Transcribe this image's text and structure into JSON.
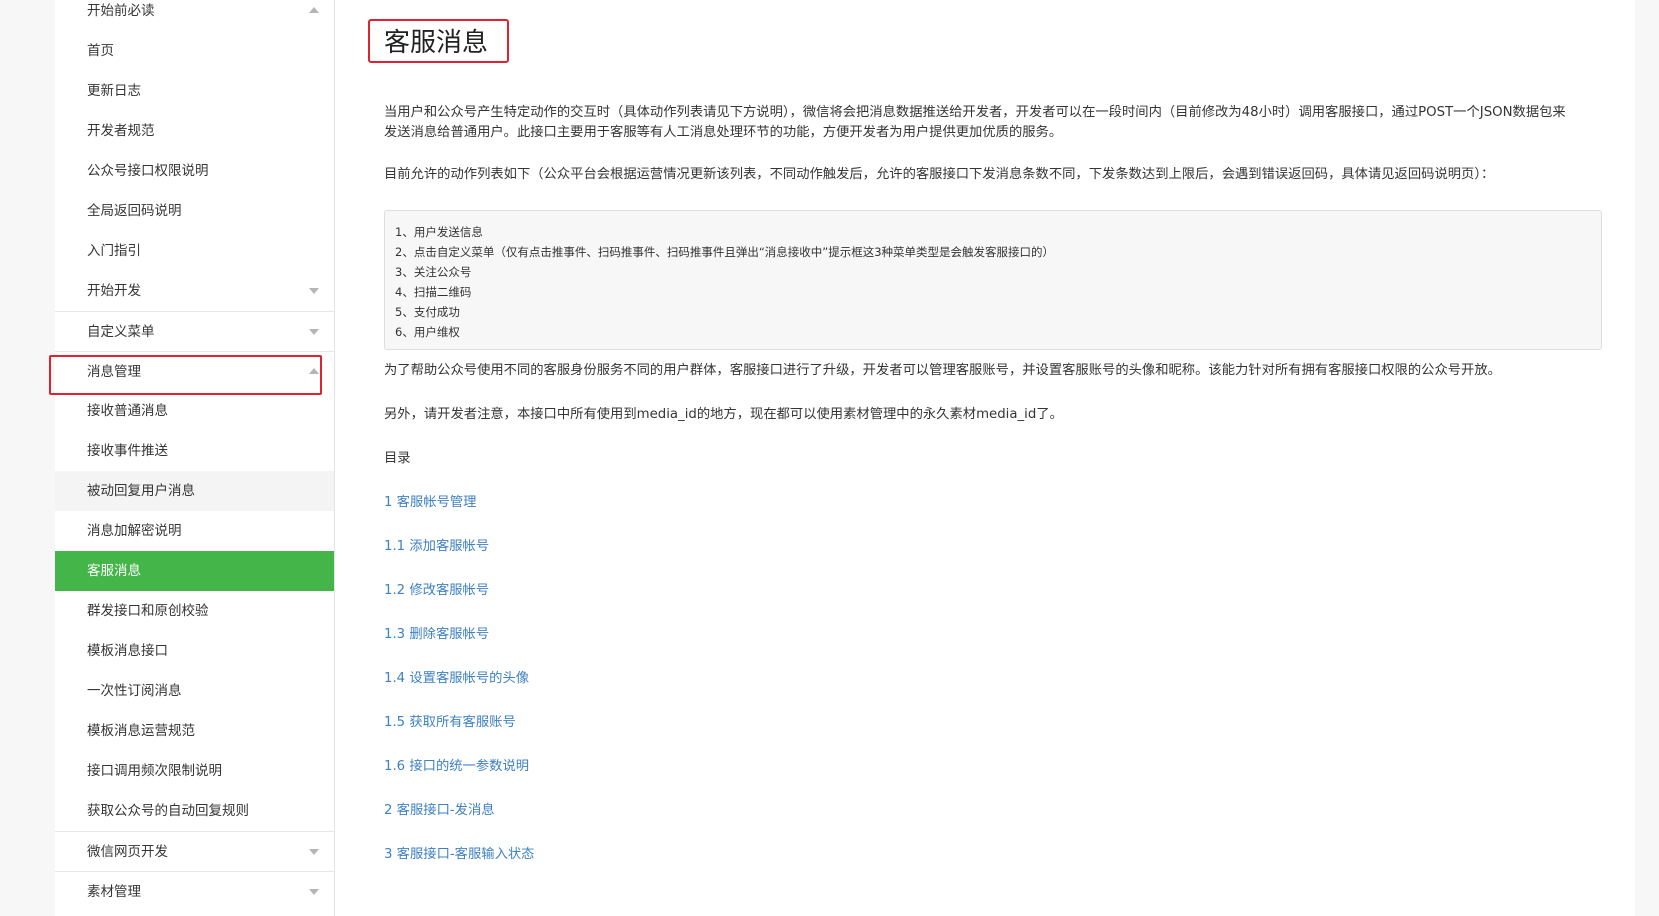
{
  "sidebar": {
    "items": [
      {
        "label": "开始前必读",
        "caret": "up",
        "group": false
      },
      {
        "label": "首页"
      },
      {
        "label": "更新日志"
      },
      {
        "label": "开发者规范"
      },
      {
        "label": "公众号接口权限说明"
      },
      {
        "label": "全局返回码说明"
      },
      {
        "label": "入门指引"
      },
      {
        "label": "开始开发",
        "caret": "down"
      },
      {
        "label": "自定义菜单",
        "caret": "down",
        "group": true
      },
      {
        "label": "消息管理",
        "caret": "up",
        "group": true
      },
      {
        "label": "接收普通消息"
      },
      {
        "label": "接收事件推送"
      },
      {
        "label": "被动回复用户消息",
        "state": "hover"
      },
      {
        "label": "消息加解密说明"
      },
      {
        "label": "客服消息",
        "state": "active"
      },
      {
        "label": "群发接口和原创校验"
      },
      {
        "label": "模板消息接口"
      },
      {
        "label": "一次性订阅消息"
      },
      {
        "label": "模板消息运营规范"
      },
      {
        "label": "接口调用频次限制说明"
      },
      {
        "label": "获取公众号的自动回复规则"
      },
      {
        "label": "微信网页开发",
        "caret": "down",
        "group": true
      },
      {
        "label": "素材管理",
        "caret": "down",
        "group": true
      }
    ]
  },
  "main": {
    "title": "客服消息",
    "intro": "当用户和公众号产生特定动作的交互时（具体动作列表请见下方说明），微信将会把消息数据推送给开发者，开发者可以在一段时间内（目前修改为48小时）调用客服接口，通过POST一个JSON数据包来发送消息给普通用户。此接口主要用于客服等有人工消息处理环节的功能，方便开发者为用户提供更加优质的服务。",
    "allowed_actions_intro": "目前允许的动作列表如下（公众平台会根据运营情况更新该列表，不同动作触发后，允许的客服接口下发消息条数不同，下发条数达到上限后，会遇到错误返回码，具体请见返回码说明页）：",
    "actions": [
      "1、用户发送信息",
      "2、点击自定义菜单（仅有点击推事件、扫码推事件、扫码推事件且弹出“消息接收中”提示框这3种菜单类型是会触发客服接口的）",
      "3、关注公众号",
      "4、扫描二维码",
      "5、支付成功",
      "6、用户维权"
    ],
    "upgrade_note": "为了帮助公众号使用不同的客服身份服务不同的用户群体，客服接口进行了升级，开发者可以管理客服账号，并设置客服账号的头像和昵称。该能力针对所有拥有客服接口权限的公众号开放。",
    "media_note": "另外，请开发者注意，本接口中所有使用到media_id的地方，现在都可以使用素材管理中的永久素材media_id了。",
    "toc_heading": "目录",
    "toc": [
      "1 客服帐号管理",
      "1.1 添加客服帐号",
      "1.2 修改客服帐号",
      "1.3 删除客服帐号",
      "1.4 设置客服帐号的头像",
      "1.5 获取所有客服账号",
      "1.6 接口的统一参数说明",
      "2 客服接口-发消息",
      "3 客服接口-客服输入状态"
    ]
  },
  "colors": {
    "active_nav": "#44b549",
    "highlight_box": "#e0222e",
    "link": "#3e81c2"
  }
}
